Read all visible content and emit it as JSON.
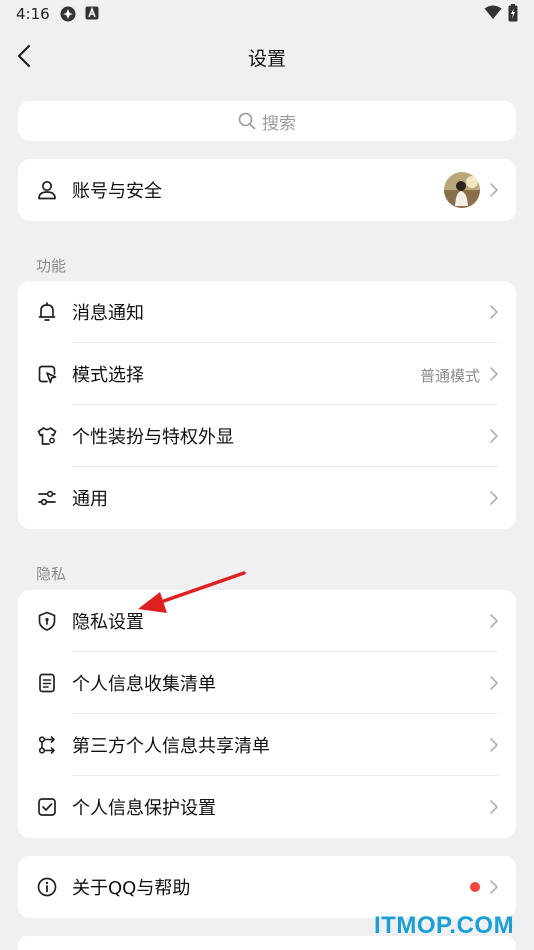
{
  "status_bar": {
    "time": "4:16"
  },
  "header": {
    "title": "设置"
  },
  "search": {
    "placeholder": "搜索"
  },
  "account": {
    "label": "账号与安全"
  },
  "sections": {
    "features": {
      "title": "功能",
      "items": [
        {
          "label": "消息通知"
        },
        {
          "label": "模式选择",
          "value": "普通模式"
        },
        {
          "label": "个性装扮与特权外显"
        },
        {
          "label": "通用"
        }
      ]
    },
    "privacy": {
      "title": "隐私",
      "items": [
        {
          "label": "隐私设置"
        },
        {
          "label": "个人信息收集清单"
        },
        {
          "label": "第三方个人信息共享清单"
        },
        {
          "label": "个人信息保护设置"
        }
      ]
    }
  },
  "about": {
    "label": "关于QQ与帮助"
  },
  "watermark": {
    "text": "ITMOP.COM"
  },
  "colors": {
    "background": "#f0f0f3",
    "card": "#ffffff",
    "text_primary": "#111111",
    "text_secondary": "#8a8a90",
    "chevron": "#b0b0b5",
    "red_dot": "#f2463c",
    "annotation_arrow": "#e02020",
    "watermark": "#1a9fd6"
  }
}
